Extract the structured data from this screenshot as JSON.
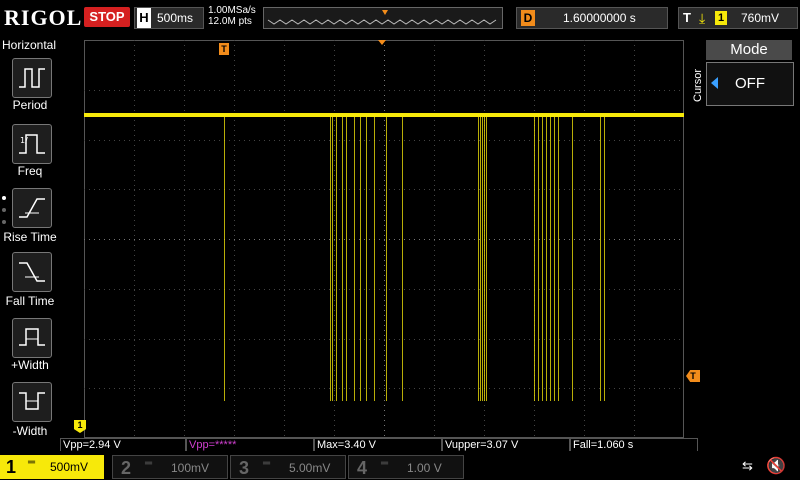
{
  "header": {
    "logo": "RIGOL",
    "run_state": "STOP",
    "timebase_letter": "H",
    "timebase": "500ms",
    "sample_rate": "1.00MSa/s",
    "memory_depth": "12.0M pts",
    "delay_letter": "D",
    "delay": "1.60000000 s",
    "trigger_letter": "T",
    "trigger_source": "1",
    "trigger_level": "760mV"
  },
  "left_panel": {
    "title": "Horizontal",
    "items": [
      {
        "label": "Period",
        "icon": "period-icon"
      },
      {
        "label": "Freq",
        "icon": "freq-icon"
      },
      {
        "label": "Rise Time",
        "icon": "rise-time-icon"
      },
      {
        "label": "Fall Time",
        "icon": "fall-time-icon"
      },
      {
        "label": "+Width",
        "icon": "pos-width-icon"
      },
      {
        "label": "-Width",
        "icon": "neg-width-icon"
      }
    ]
  },
  "right_panel": {
    "section": "Cursor",
    "mode_title": "Mode",
    "mode_value": "OFF"
  },
  "measurements": [
    {
      "text": "Vpp=2.94 V",
      "color": "#ffffff"
    },
    {
      "text": "Vpp=*****",
      "color": "#d040d0"
    },
    {
      "text": "Max=3.40 V",
      "color": "#ffffff"
    },
    {
      "text": "Vupper=3.07 V",
      "color": "#ffffff"
    },
    {
      "text": "Fall=1.060 s",
      "color": "#ffffff"
    }
  ],
  "channels": [
    {
      "num": "1",
      "scale": "500mV",
      "active": true,
      "color": "#f7e90a"
    },
    {
      "num": "2",
      "scale": "100mV",
      "active": false,
      "color": "#00c8c8"
    },
    {
      "num": "3",
      "scale": "5.00mV",
      "active": false,
      "color": "#d040d0"
    },
    {
      "num": "4",
      "scale": "1.00 V",
      "active": false,
      "color": "#3a7fff"
    }
  ],
  "markers": {
    "trigger_position": "T",
    "trigger_level": "T",
    "ground": "1"
  },
  "colors": {
    "ch1": "#f7e90a",
    "stop": "#d52020",
    "delay_badge": "#f28c1b",
    "cursor_arrow": "#3aa0ff"
  }
}
